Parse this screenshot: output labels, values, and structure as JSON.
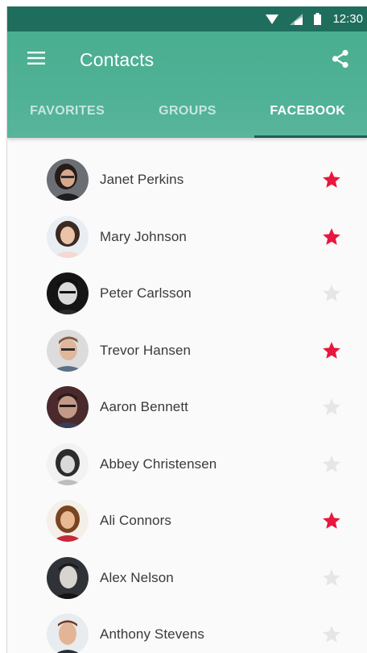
{
  "status": {
    "time": "12:30"
  },
  "appbar": {
    "title": "Contacts",
    "tabs": [
      {
        "label": "FAVORITES",
        "active": false
      },
      {
        "label": "GROUPS",
        "active": false
      },
      {
        "label": "FACEBOOK",
        "active": true
      }
    ]
  },
  "colors": {
    "statusbar": "#1f6e5d",
    "appbar": "#4fb196",
    "star_on": "#e8173d",
    "star_off": "#e6e6e6"
  },
  "contacts": [
    {
      "name": "Janet Perkins",
      "favorite": true
    },
    {
      "name": "Mary Johnson",
      "favorite": true
    },
    {
      "name": "Peter Carlsson",
      "favorite": false
    },
    {
      "name": "Trevor Hansen",
      "favorite": true
    },
    {
      "name": "Aaron Bennett",
      "favorite": false
    },
    {
      "name": "Abbey Christensen",
      "favorite": false
    },
    {
      "name": "Ali Connors",
      "favorite": true
    },
    {
      "name": "Alex Nelson",
      "favorite": false
    },
    {
      "name": "Anthony Stevens",
      "favorite": false
    }
  ]
}
